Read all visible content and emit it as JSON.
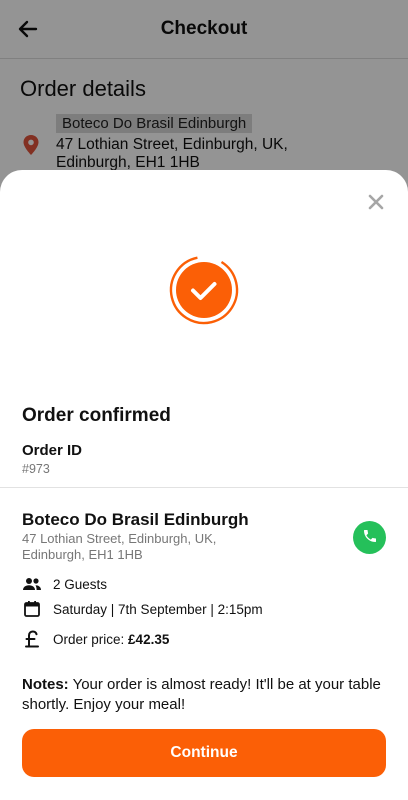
{
  "header": {
    "title": "Checkout"
  },
  "order_details": {
    "title": "Order details",
    "restaurant_name": "Boteco Do Brasil Edinburgh",
    "address": "47 Lothian Street, Edinburgh, UK, Edinburgh, EH1 1HB"
  },
  "modal": {
    "status_title": "Order confirmed",
    "order_id_label": "Order ID",
    "order_id_value": "#973",
    "restaurant_name": "Boteco Do Brasil Edinburgh",
    "restaurant_address": "47 Lothian Street, Edinburgh, UK, Edinburgh, EH1 1HB",
    "guests": "2 Guests",
    "datetime": "Saturday | 7th September | 2:15pm",
    "price_label": "Order price:",
    "price_value": "£42.35",
    "notes_label": "Notes:",
    "notes_text": "Your order is almost ready! It'll be at your table shortly. Enjoy your meal!",
    "continue_label": "Continue"
  },
  "colors": {
    "accent": "#fb5f06",
    "phone_green": "#25c05a"
  },
  "icons": [
    "back-arrow-icon",
    "location-pin-icon",
    "close-icon",
    "check-circle-icon",
    "phone-icon",
    "guests-icon",
    "calendar-icon",
    "pound-icon"
  ]
}
